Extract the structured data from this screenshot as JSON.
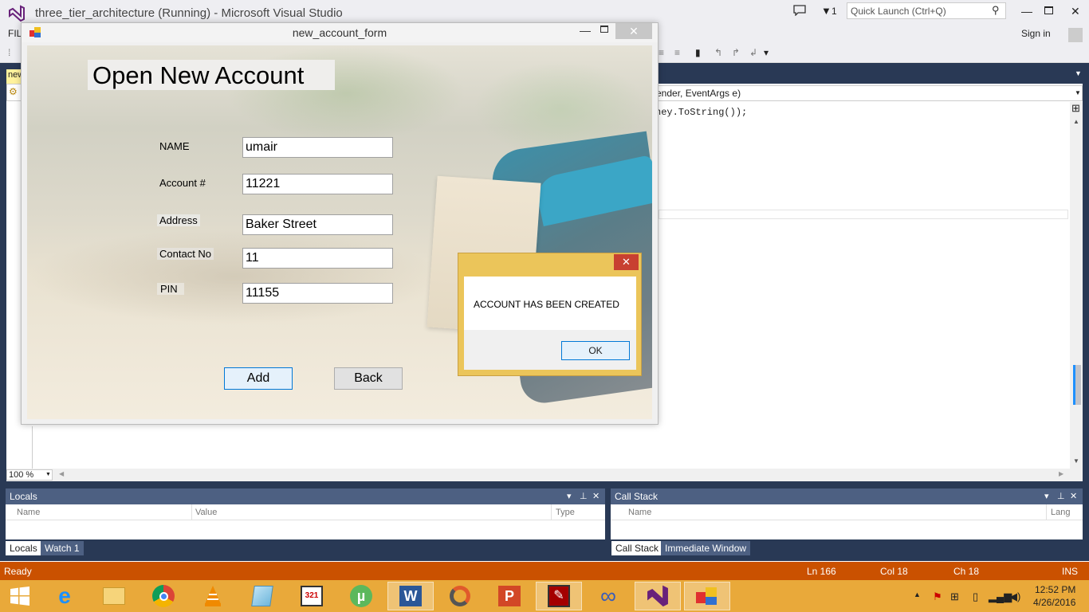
{
  "vs": {
    "title": "three_tier_architecture (Running) - Microsoft Visual Studio",
    "filter_count": "1",
    "quick_launch_placeholder": "Quick Launch (Ctrl+Q)",
    "menu_file": "FIL",
    "sign_in": "Sign in",
    "doc_tab": "new",
    "nav_dropdown": "ender, EventArgs e)",
    "code_line": "ney.ToString());",
    "zoom": "100 %"
  },
  "locals": {
    "title": "Locals",
    "columns": [
      "Name",
      "Value",
      "Type"
    ],
    "tabs": [
      "Locals",
      "Watch 1"
    ]
  },
  "callstack": {
    "title": "Call Stack",
    "columns": [
      "Name",
      "Lang"
    ],
    "tabs": [
      "Call Stack",
      "Immediate Window"
    ]
  },
  "status": {
    "text": "Ready",
    "ln": "Ln 166",
    "col": "Col 18",
    "ch": "Ch 18",
    "ins": "INS"
  },
  "taskbar": {
    "time": "12:52 PM",
    "date": "4/26/2016",
    "apps": [
      "start-icon",
      "ie-icon",
      "file-explorer-icon",
      "chrome-icon",
      "vlc-icon",
      "notepad-icon",
      "media-player-icon",
      "utorrent-icon",
      "word-icon",
      "app-icon",
      "powerpoint-icon",
      "acrobat-icon",
      "infinity-icon",
      "visual-studio-icon",
      "winform-app-icon"
    ]
  },
  "form": {
    "window_title": "new_account_form",
    "heading": "Open New Account",
    "fields": [
      {
        "label": "NAME",
        "value": "umair"
      },
      {
        "label": "Account #",
        "value": "11221"
      },
      {
        "label": "Address",
        "value": "Baker Street"
      },
      {
        "label": "Contact No",
        "value": "11"
      },
      {
        "label": "PIN",
        "value": "11155"
      }
    ],
    "add_label": "Add",
    "back_label": "Back"
  },
  "messagebox": {
    "text": "ACCOUNT HAS BEEN CREATED",
    "ok_label": "OK"
  },
  "colors": {
    "accent": "#0078d7",
    "status_bar": "#ca5100",
    "taskbar": "#e9a93a",
    "vs_dark": "#293955"
  }
}
